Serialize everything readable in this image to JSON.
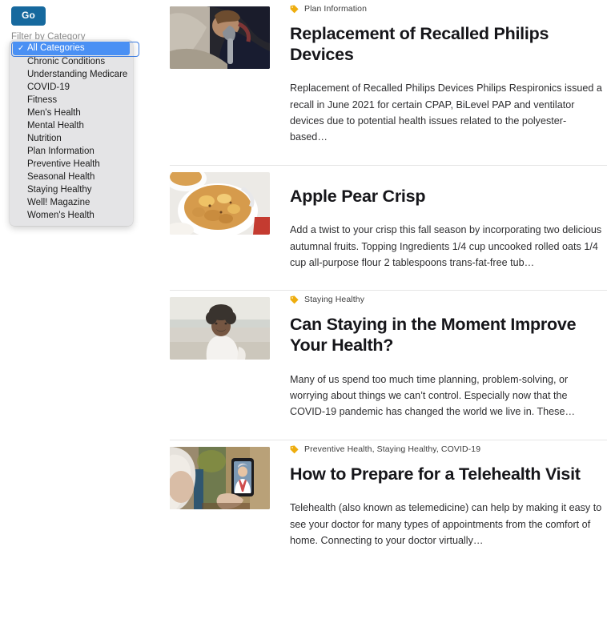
{
  "filter": {
    "go_label": "Go",
    "label": "Filter by Category",
    "selected": "All Categories",
    "check_glyph": "✓",
    "options": [
      "All Categories",
      "Chronic Conditions",
      "Understanding Medicare",
      "COVID-19",
      "Fitness",
      "Men's Health",
      "Mental Health",
      "Nutrition",
      "Plan Information",
      "Preventive Health",
      "Seasonal Health",
      "Staying Healthy",
      "Well! Magazine",
      "Women's Health"
    ]
  },
  "colors": {
    "go_button": "#16699e",
    "highlight": "#4a90f4",
    "tag_icon": "#eead0e",
    "divider": "#e6e6e6",
    "title": "#16161a",
    "popup_bg": "#e4e4e6"
  },
  "articles": [
    {
      "tags": "Plan Information",
      "has_tag": true,
      "title": "Replacement of Recalled Philips Devices",
      "excerpt": "Replacement of Recalled Philips Devices Philips Respironics issued a recall in June 2021 for certain CPAP, BiLevel PAP and ventilator devices due to potential health issues related to the polyester-based…",
      "thumb_name": "person-sleeping-with-cpap-mask-photo"
    },
    {
      "tags": "",
      "has_tag": false,
      "title": "Apple Pear Crisp",
      "excerpt": "Add a twist to your crisp this fall season by incorporating two delicious autumnal fruits. Topping Ingredients 1/4 cup uncooked rolled oats 1/4 cup all-purpose flour 2 tablespoons trans-fat-free tub…",
      "thumb_name": "bowl-of-apple-pear-crisp-photo"
    },
    {
      "tags": "Staying Healthy",
      "has_tag": true,
      "title": "Can Staying in the Moment Improve Your Health?",
      "excerpt": "Many of us spend too much time planning, problem-solving, or worrying about things we can’t control. Especially now that the COVID-19 pandemic has changed the world we live in. These…",
      "thumb_name": "smiling-woman-on-beach-photo"
    },
    {
      "tags": "Preventive Health, Staying Healthy, COVID-19",
      "has_tag": true,
      "title": "How to Prepare for a Telehealth Visit",
      "excerpt": "Telehealth (also known as telemedicine) can help by making it easy to see your doctor for many types of appointments from the comfort of home. Connecting to your doctor virtually…",
      "thumb_name": "person-holding-phone-telehealth-call-photo"
    }
  ]
}
